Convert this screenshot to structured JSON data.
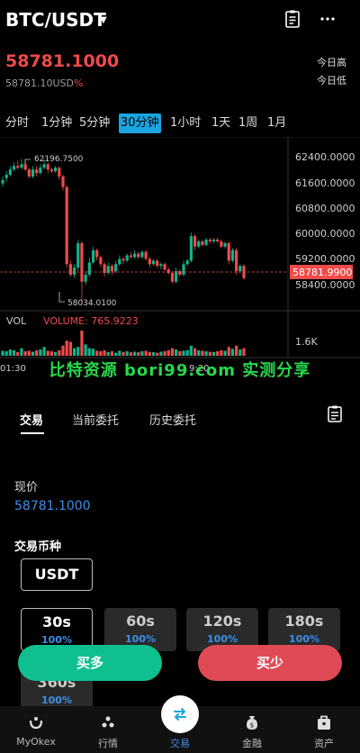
{
  "header": {
    "pair": "BTC/USDT",
    "caret": "▼"
  },
  "ticker": {
    "price": "58781.1000",
    "sub_price": "58781.10USD",
    "pct": "%",
    "high_label": "今日高",
    "low_label": "今日低"
  },
  "timeframes": [
    "分时",
    "1分钟",
    "5分钟",
    "30分钟",
    "1小时",
    "1天",
    "1周",
    "1月"
  ],
  "active_timeframe": "30分钟",
  "chart_data": {
    "type": "candlestick",
    "y_ticks": [
      "62400.0000",
      "61600.0000",
      "60800.0000",
      "60000.0000",
      "59200.0000",
      "58400.0000"
    ],
    "current_price_tag": "58781.9900",
    "max_annotation": "62196.7500",
    "min_annotation": "58034.0100",
    "volume_label": "VOL",
    "volume_value": "VOLUME: 765.9223",
    "volume_tick": "1.6K",
    "time_ticks": [
      "01:30",
      "9:20"
    ],
    "ylim": [
      58000,
      62700
    ],
    "candles": [
      {
        "o": 61500,
        "c": 61600,
        "h": 61700,
        "l": 61400
      },
      {
        "o": 61650,
        "c": 61750,
        "h": 61850,
        "l": 61550
      },
      {
        "o": 61750,
        "c": 61900,
        "h": 62000,
        "l": 61700
      },
      {
        "o": 61900,
        "c": 62000,
        "h": 62100,
        "l": 61850
      },
      {
        "o": 62000,
        "c": 61950,
        "h": 62150,
        "l": 61900
      },
      {
        "o": 61950,
        "c": 62050,
        "h": 62200,
        "l": 61900
      },
      {
        "o": 62050,
        "c": 61900,
        "h": 62150,
        "l": 61850
      },
      {
        "o": 61900,
        "c": 61700,
        "h": 61950,
        "l": 61650
      },
      {
        "o": 61700,
        "c": 61900,
        "h": 62000,
        "l": 61650
      },
      {
        "o": 61900,
        "c": 61800,
        "h": 62000,
        "l": 61700
      },
      {
        "o": 61800,
        "c": 61950,
        "h": 62050,
        "l": 61750
      },
      {
        "o": 61950,
        "c": 62050,
        "h": 62197,
        "l": 61900
      },
      {
        "o": 62050,
        "c": 61900,
        "h": 62100,
        "l": 61800
      },
      {
        "o": 61900,
        "c": 61850,
        "h": 61950,
        "l": 61800
      },
      {
        "o": 61850,
        "c": 61950,
        "h": 62000,
        "l": 61800
      },
      {
        "o": 61950,
        "c": 61700,
        "h": 61990,
        "l": 61600
      },
      {
        "o": 61700,
        "c": 61400,
        "h": 61750,
        "l": 61300
      },
      {
        "o": 61400,
        "c": 59200,
        "h": 61450,
        "l": 59100
      },
      {
        "o": 59200,
        "c": 58900,
        "h": 59300,
        "l": 58850
      },
      {
        "o": 58900,
        "c": 59100,
        "h": 59200,
        "l": 58800
      },
      {
        "o": 59100,
        "c": 59800,
        "h": 59900,
        "l": 59000
      },
      {
        "o": 59800,
        "c": 58700,
        "h": 59850,
        "l": 58034
      },
      {
        "o": 58700,
        "c": 58900,
        "h": 59000,
        "l": 58600
      },
      {
        "o": 58900,
        "c": 59250,
        "h": 59400,
        "l": 58850
      },
      {
        "o": 59250,
        "c": 59600,
        "h": 59700,
        "l": 59200
      },
      {
        "o": 59600,
        "c": 59400,
        "h": 59650,
        "l": 59300
      },
      {
        "o": 59400,
        "c": 59200,
        "h": 59450,
        "l": 59100
      },
      {
        "o": 59200,
        "c": 58950,
        "h": 59250,
        "l": 58850
      },
      {
        "o": 58950,
        "c": 59150,
        "h": 59250,
        "l": 58900
      },
      {
        "o": 59150,
        "c": 59000,
        "h": 59200,
        "l": 58900
      },
      {
        "o": 59000,
        "c": 59200,
        "h": 59300,
        "l": 58950
      },
      {
        "o": 59200,
        "c": 59350,
        "h": 59450,
        "l": 59150
      },
      {
        "o": 59350,
        "c": 59300,
        "h": 59400,
        "l": 59200
      },
      {
        "o": 59300,
        "c": 59450,
        "h": 59500,
        "l": 59250
      },
      {
        "o": 59450,
        "c": 59400,
        "h": 59550,
        "l": 59350
      },
      {
        "o": 59400,
        "c": 59500,
        "h": 59600,
        "l": 59350
      },
      {
        "o": 59500,
        "c": 59400,
        "h": 59550,
        "l": 59350
      },
      {
        "o": 59400,
        "c": 59550,
        "h": 59600,
        "l": 59350
      },
      {
        "o": 59550,
        "c": 59350,
        "h": 59600,
        "l": 59300
      },
      {
        "o": 59350,
        "c": 59200,
        "h": 59400,
        "l": 59100
      },
      {
        "o": 59200,
        "c": 59300,
        "h": 59350,
        "l": 59150
      },
      {
        "o": 59300,
        "c": 59150,
        "h": 59350,
        "l": 59100
      },
      {
        "o": 59150,
        "c": 59200,
        "h": 59250,
        "l": 59050
      },
      {
        "o": 59200,
        "c": 59050,
        "h": 59250,
        "l": 59000
      },
      {
        "o": 59050,
        "c": 58950,
        "h": 59100,
        "l": 58900
      },
      {
        "o": 58950,
        "c": 58700,
        "h": 59000,
        "l": 58650
      },
      {
        "o": 58700,
        "c": 59000,
        "h": 59100,
        "l": 58650
      },
      {
        "o": 59000,
        "c": 58900,
        "h": 59050,
        "l": 58850
      },
      {
        "o": 58900,
        "c": 59200,
        "h": 59300,
        "l": 58850
      },
      {
        "o": 59200,
        "c": 59300,
        "h": 59350,
        "l": 59150
      },
      {
        "o": 59300,
        "c": 60000,
        "h": 60100,
        "l": 59250
      },
      {
        "o": 60000,
        "c": 59700,
        "h": 60050,
        "l": 59600
      },
      {
        "o": 59700,
        "c": 59850,
        "h": 59900,
        "l": 59650
      },
      {
        "o": 59850,
        "c": 59750,
        "h": 59900,
        "l": 59700
      },
      {
        "o": 59750,
        "c": 59900,
        "h": 59950,
        "l": 59700
      },
      {
        "o": 59900,
        "c": 59850,
        "h": 59950,
        "l": 59800
      },
      {
        "o": 59850,
        "c": 59900,
        "h": 59950,
        "l": 59800
      },
      {
        "o": 59900,
        "c": 59850,
        "h": 59950,
        "l": 59800
      },
      {
        "o": 59850,
        "c": 59700,
        "h": 59900,
        "l": 59650
      },
      {
        "o": 59700,
        "c": 59800,
        "h": 59850,
        "l": 59650
      },
      {
        "o": 59800,
        "c": 59300,
        "h": 59850,
        "l": 59200
      },
      {
        "o": 59300,
        "c": 59600,
        "h": 59650,
        "l": 59250
      },
      {
        "o": 59600,
        "c": 59000,
        "h": 59650,
        "l": 58900
      },
      {
        "o": 59000,
        "c": 59150,
        "h": 59200,
        "l": 58950
      },
      {
        "o": 59150,
        "c": 58800,
        "h": 59200,
        "l": 58750
      }
    ],
    "volumes": [
      20,
      18,
      25,
      22,
      15,
      30,
      18,
      20,
      16,
      22,
      25,
      35,
      20,
      18,
      15,
      22,
      40,
      60,
      55,
      30,
      35,
      100,
      45,
      30,
      28,
      20,
      18,
      22,
      15,
      18,
      12,
      20,
      15,
      18,
      14,
      16,
      14,
      18,
      20,
      15,
      14,
      12,
      16,
      18,
      22,
      30,
      25,
      18,
      20,
      22,
      40,
      30,
      22,
      20,
      18,
      16,
      15,
      18,
      22,
      20,
      35,
      28,
      40,
      25,
      30
    ]
  },
  "watermark": "比特资源 bori99.com 实测分享",
  "order_tabs": [
    "交易",
    "当前委托",
    "历史委托"
  ],
  "active_order_tab": "交易",
  "current_price_label": "现价",
  "current_price_value": "58781.1000",
  "currency_label": "交易币种",
  "currency_value": "USDT",
  "durations": [
    {
      "time": "30s",
      "pct": "100%"
    },
    {
      "time": "60s",
      "pct": "100%"
    },
    {
      "time": "120s",
      "pct": "100%"
    },
    {
      "time": "180s",
      "pct": "100%"
    },
    {
      "time": "360s",
      "pct": "100%"
    }
  ],
  "buy_label": "买多",
  "sell_label": "买少",
  "nav": [
    {
      "label": "MyOkex",
      "icon": "logo-icon"
    },
    {
      "label": "行情",
      "icon": "market-icon"
    },
    {
      "label": "交易",
      "icon": "trade-icon"
    },
    {
      "label": "金融",
      "icon": "finance-icon"
    },
    {
      "label": "资产",
      "icon": "assets-icon"
    }
  ],
  "colors": {
    "up": "#10b38a",
    "down": "#f04a4a",
    "accent": "#3d8ee8",
    "buy": "#0fbf8f",
    "sell": "#e04a55"
  }
}
